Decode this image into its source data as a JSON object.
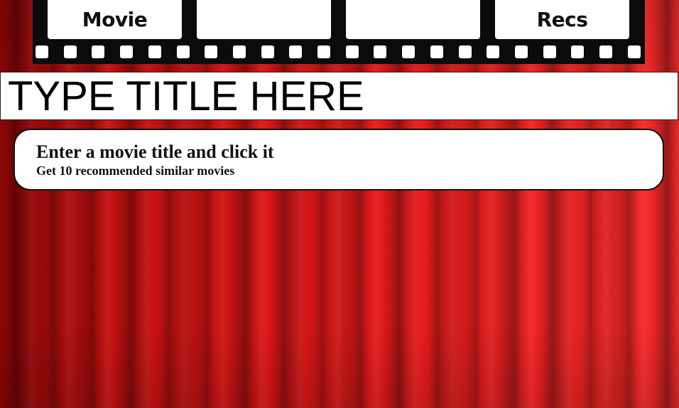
{
  "banner": {
    "frames": [
      {
        "label": "Movie"
      },
      {
        "label": ""
      },
      {
        "label": ""
      },
      {
        "label": "Recs"
      }
    ]
  },
  "search": {
    "placeholder": "TYPE TITLE HERE",
    "value": ""
  },
  "instructions": {
    "heading": "Enter a movie title and click it",
    "subtext": "Get 10 recommended similar movies"
  },
  "colors": {
    "curtain": "#e01818",
    "film": "#0b0b0b",
    "frame": "#ffffff"
  }
}
